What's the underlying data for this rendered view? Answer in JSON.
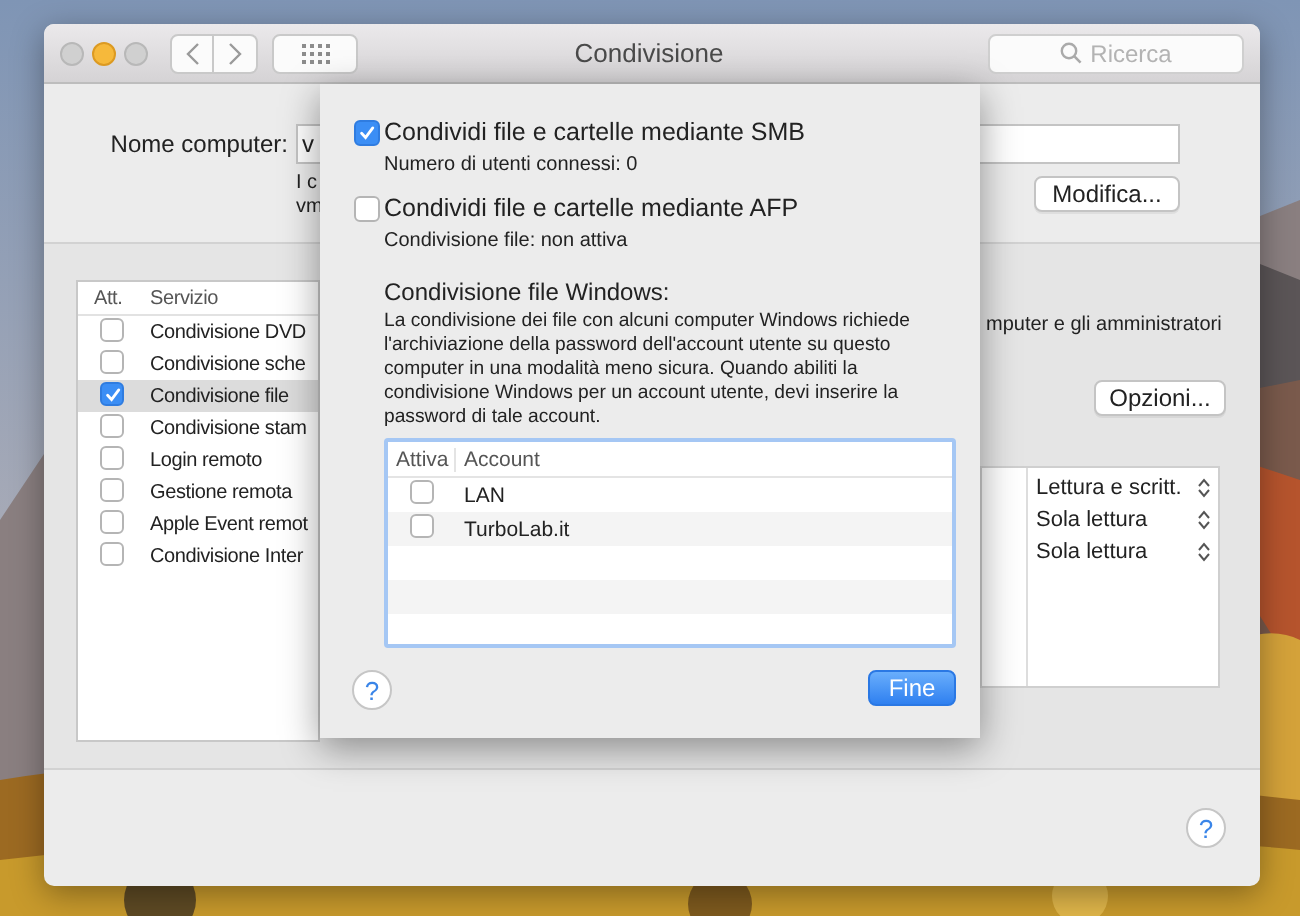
{
  "window": {
    "title": "Condivisione",
    "search": {
      "placeholder": "Ricerca"
    }
  },
  "computer_name": {
    "label": "Nome computer:",
    "value": "v",
    "note_lines": [
      "I c",
      "vm"
    ],
    "edit_button": "Modifica..."
  },
  "services": {
    "columns": [
      "Att.",
      "Servizio"
    ],
    "rows": [
      {
        "name": "Condivisione DVD",
        "checked": false,
        "selected": false
      },
      {
        "name": "Condivisione sche",
        "checked": false,
        "selected": false
      },
      {
        "name": "Condivisione file",
        "checked": true,
        "selected": true
      },
      {
        "name": "Condivisione stam",
        "checked": false,
        "selected": false
      },
      {
        "name": "Login remoto",
        "checked": false,
        "selected": false
      },
      {
        "name": "Gestione remota",
        "checked": false,
        "selected": false
      },
      {
        "name": "Apple Event remot",
        "checked": false,
        "selected": false
      },
      {
        "name": "Condivisione Inter",
        "checked": false,
        "selected": false
      }
    ]
  },
  "access": {
    "text": "mputer e gli amministratori",
    "options_button": "Opzioni...",
    "permissions": [
      {
        "value": "Lettura e scritt."
      },
      {
        "value": "Sola lettura"
      },
      {
        "value": "Sola lettura"
      }
    ]
  },
  "help": "?",
  "sheet": {
    "protocols": [
      {
        "label": "Condividi file e cartelle mediante SMB",
        "checked": true,
        "status": "Numero di utenti connessi: 0"
      },
      {
        "label": "Condividi file e cartelle mediante AFP",
        "checked": false,
        "status": "Condivisione file: non attiva"
      }
    ],
    "windows_heading": "Condivisione file Windows:",
    "windows_text": "La condivisione dei file con alcuni computer Windows richiede l'archiviazione della password dell'account utente su questo computer in una modalità meno sicura. Quando abiliti la condivisione Windows per un account utente, devi inserire la password di tale account.",
    "accounts": {
      "columns": [
        "Attiva",
        "Account"
      ],
      "rows": [
        {
          "name": "LAN",
          "checked": false
        },
        {
          "name": "TurboLab.it",
          "checked": false
        }
      ]
    },
    "help": "?",
    "done_button": "Fine"
  }
}
